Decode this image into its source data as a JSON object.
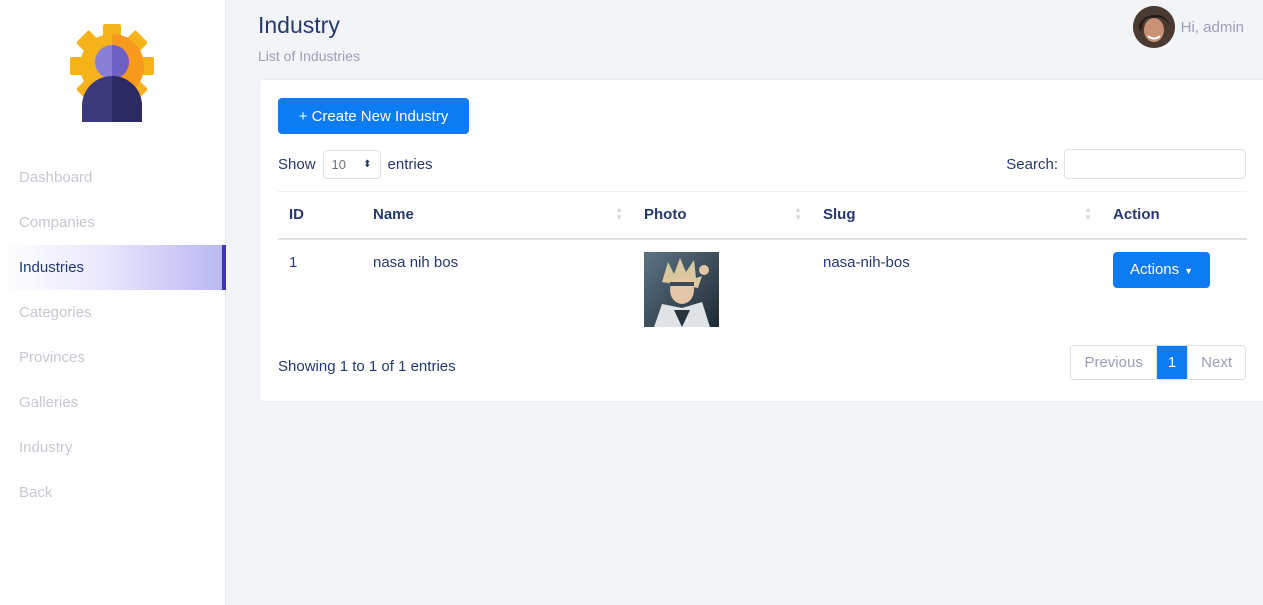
{
  "colors": {
    "accent": "#0d7cf2",
    "sidebar_active_bar": "#3b36b0",
    "logo_gear": "#f5b21b",
    "logo_figure": "#3d3a7c"
  },
  "sidebar": {
    "logo_icon": "user-gear-icon",
    "items": [
      {
        "label": "Dashboard",
        "active": false
      },
      {
        "label": "Companies",
        "active": false
      },
      {
        "label": "Industries",
        "active": true
      },
      {
        "label": "Categories",
        "active": false
      },
      {
        "label": "Provinces",
        "active": false
      },
      {
        "label": "Galleries",
        "active": false
      },
      {
        "label": "Industry",
        "active": false
      },
      {
        "label": "Back",
        "active": false
      }
    ]
  },
  "header": {
    "title": "Industry",
    "subtitle": "List of Industries",
    "user_greeting": "Hi, admin"
  },
  "card": {
    "create_button": "+ Create New Industry",
    "show_label": "Show",
    "entries_label": "entries",
    "page_length": "10",
    "search_label": "Search:",
    "search_value": "",
    "columns": [
      "ID",
      "Name",
      "Photo",
      "Slug",
      "Action"
    ],
    "rows": [
      {
        "id": "1",
        "name": "nasa nih bos",
        "photo_icon": "industry-photo",
        "slug": "nasa-nih-bos",
        "action_label": "Actions"
      }
    ],
    "info": "Showing 1 to 1 of 1 entries",
    "pagination": {
      "previous": "Previous",
      "current": "1",
      "next": "Next"
    }
  }
}
